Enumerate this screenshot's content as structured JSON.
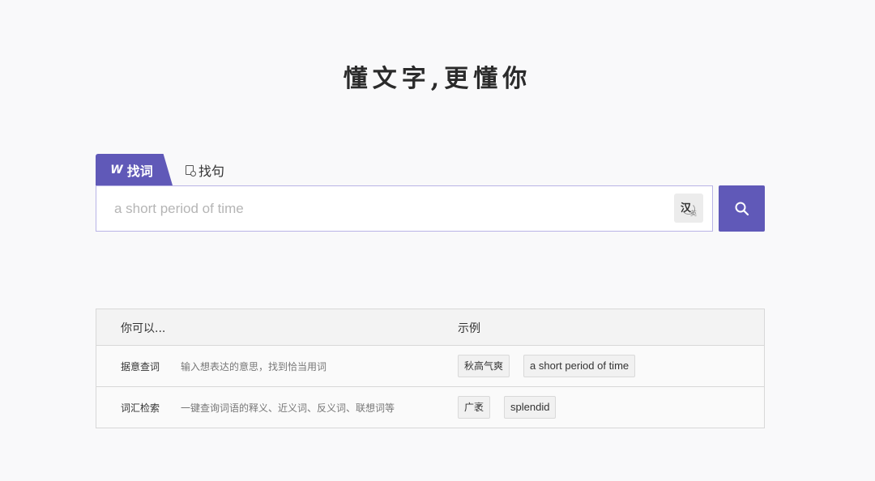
{
  "hero": {
    "title": "懂文字,更懂你"
  },
  "tabs": [
    {
      "icon_text": "W",
      "icon": "word-icon",
      "label": "找词"
    },
    {
      "icon": "document-search-icon",
      "label": "找句"
    }
  ],
  "search": {
    "placeholder": "a short period of time",
    "value": "",
    "lang_toggle": {
      "primary": "汉",
      "secondary": "英",
      "icon": "language-switch-icon"
    },
    "button_icon": "search-icon"
  },
  "help": {
    "header": {
      "col1": "你可以...",
      "col2": "示例"
    },
    "rows": [
      {
        "title": "据意查词",
        "desc": "输入想表达的意思，找到恰当用词",
        "examples": [
          "秋高气爽",
          "a short period of time"
        ]
      },
      {
        "title": "词汇检索",
        "desc": "一键查询词语的释义、近义词、反义词、联想词等",
        "examples": [
          "广袤",
          "splendid"
        ]
      }
    ]
  },
  "colors": {
    "accent": "#6059b8",
    "input_border": "#b9b4e6",
    "background": "#f9f9fa"
  }
}
